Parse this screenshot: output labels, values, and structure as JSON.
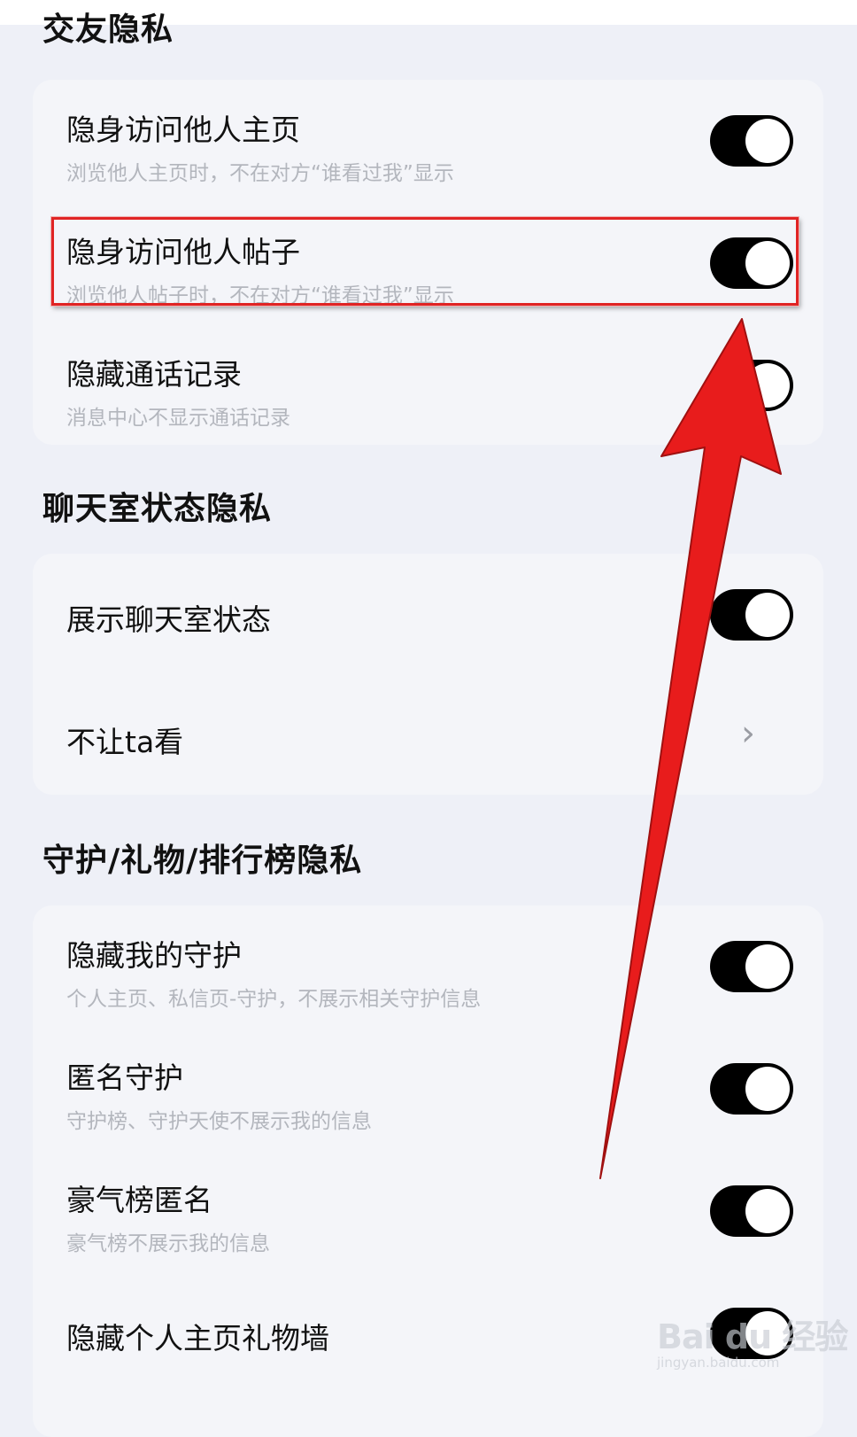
{
  "sections": [
    {
      "title": "交友隐私",
      "items": [
        {
          "title": "隐身访问他人主页",
          "subtitle": "浏览他人主页时，不在对方“谁看过我”显示",
          "control": "toggle",
          "on": true
        },
        {
          "title": "隐身访问他人帖子",
          "subtitle": "浏览他人帖子时，不在对方“谁看过我”显示",
          "control": "toggle",
          "on": true
        },
        {
          "title": "隐藏通话记录",
          "subtitle": "消息中心不显示通话记录",
          "control": "toggle",
          "on": true
        }
      ]
    },
    {
      "title": "聊天室状态隐私",
      "items": [
        {
          "title": "展示聊天室状态",
          "control": "toggle",
          "on": true
        },
        {
          "title": "不让ta看",
          "control": "chevron"
        }
      ]
    },
    {
      "title": "守护/礼物/排行榜隐私",
      "items": [
        {
          "title": "隐藏我的守护",
          "subtitle": "个人主页、私信页-守护，不展示相关守护信息",
          "control": "toggle",
          "on": true
        },
        {
          "title": "匿名守护",
          "subtitle": "守护榜、守护天使不展示我的信息",
          "control": "toggle",
          "on": true
        },
        {
          "title": "豪气榜匿名",
          "subtitle": "豪气榜不展示我的信息",
          "control": "toggle",
          "on": true
        },
        {
          "title": "隐藏个人主页礼物墙",
          "control": "toggle",
          "on": true
        }
      ]
    }
  ],
  "icons": {
    "chevron": "chevron-right-icon"
  },
  "annotation": {
    "color": "#e81c1c"
  },
  "watermark": {
    "main": "Bai du 经验",
    "sub": "jingyan.baidu.com"
  }
}
